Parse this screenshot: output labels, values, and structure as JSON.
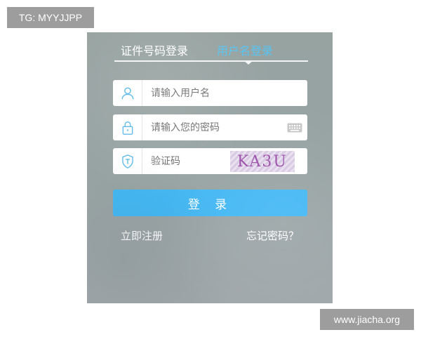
{
  "watermarks": {
    "top_left": "TG: MYYJJPP",
    "bottom_right": "www.jiacha.org"
  },
  "login": {
    "tabs": [
      {
        "label": "证件号码登录",
        "active": false
      },
      {
        "label": "用户名登录",
        "active": true
      }
    ],
    "username": {
      "placeholder": "请输入用户名",
      "value": "",
      "icon": "user-icon"
    },
    "password": {
      "placeholder": "请输入您的密码",
      "value": "",
      "icon": "lock-icon",
      "keyboard_icon": "keyboard-icon"
    },
    "captcha": {
      "placeholder": "验证码",
      "value": "",
      "icon": "shield-icon",
      "image_text": "KA3U"
    },
    "submit_label": "登 录",
    "register_label": "立即注册",
    "forgot_label": "忘记密码？"
  },
  "colors": {
    "panel_bg": "#97a3a1",
    "accent": "#45b8f4",
    "active_tab": "#56c3f2"
  }
}
